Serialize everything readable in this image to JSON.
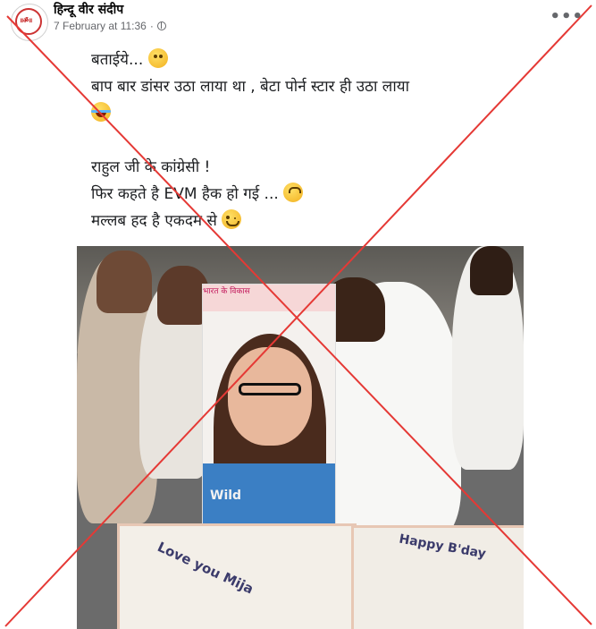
{
  "post": {
    "author": "हिन्दू वीर संदीप",
    "timestamp": "7 February at 11:36",
    "more_label": "•••"
  },
  "caption": {
    "lines": [
      "बताईये...",
      "बाप बार डांसर उठा लाया था , बेटा पोर्न स्टार ही उठा लाया",
      "",
      "राहुल जी के कांग्रेसी !",
      "फिर कहते है EVM हैक हो गई ...",
      "मल्लब हद है एकदम से"
    ]
  },
  "image": {
    "poster_banner": "भारत के विकास",
    "shirt_text": "Wild",
    "cake_left_text": "Love you Mija",
    "cake_right_text": "Happy B'day"
  },
  "icons": {
    "emoji_1": "rolling-eyes-emoji",
    "emoji_2": "crying-laughing-emoji",
    "emoji_3": "upside-down-face-emoji",
    "emoji_4": "winking-face-emoji",
    "privacy": "globe-icon"
  },
  "colors": {
    "cross_stroke": "#e53935",
    "text": "#1c1e21",
    "meta": "#65676b"
  }
}
